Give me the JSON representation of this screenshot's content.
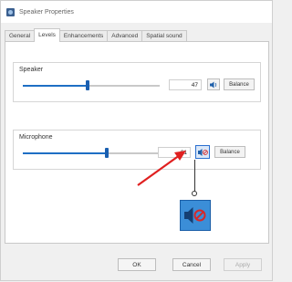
{
  "window": {
    "title": "Speaker Properties"
  },
  "tabs": [
    {
      "label": "General"
    },
    {
      "label": "Levels",
      "active": true
    },
    {
      "label": "Enhancements"
    },
    {
      "label": "Advanced"
    },
    {
      "label": "Spatial sound"
    }
  ],
  "speaker": {
    "label": "Speaker",
    "level": 47,
    "balance_label": "Balance"
  },
  "microphone": {
    "label": "Microphone",
    "level": 61,
    "muted": true,
    "balance_label": "Balance"
  },
  "footer": {
    "ok_label": "OK",
    "cancel_label": "Cancel",
    "apply_label": "Apply"
  },
  "colors": {
    "accent": "#1e6fc4",
    "highlight_arrow": "#e02020",
    "zoom_box": "#3b8ed8",
    "mute_red": "#d62828"
  },
  "icons": {
    "speaker": "speaker-icon",
    "mute": "mute-icon",
    "title": "speaker-properties-icon"
  }
}
